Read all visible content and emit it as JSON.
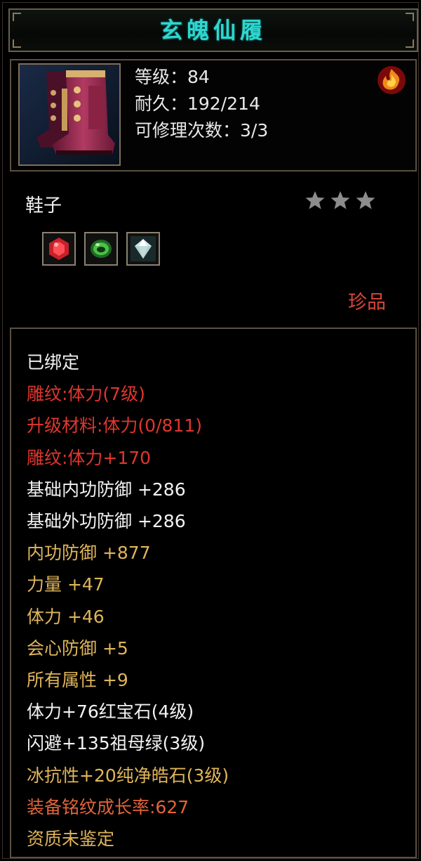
{
  "item": {
    "name": "玄魄仙履",
    "level": "等级：84",
    "durability": "耐久：192/214",
    "repair_count": "可修理次数：3/3",
    "type": "鞋子",
    "stars": 3,
    "rarity": "珍品"
  },
  "gems": [
    {
      "icon": "ruby-gem-icon",
      "color": "#c8202a"
    },
    {
      "icon": "emerald-gem-icon",
      "color": "#3aa83c"
    },
    {
      "icon": "diamond-gem-icon",
      "color": "#cfe6e6"
    }
  ],
  "attributes": [
    {
      "text": "已绑定",
      "style": "w"
    },
    {
      "text": "雕纹:体力(7级)",
      "style": "r"
    },
    {
      "text": "升级材料:体力(0/811)",
      "style": "r"
    },
    {
      "text": "雕纹:体力+170",
      "style": "r"
    },
    {
      "text": "基础内功防御  +286",
      "style": "w"
    },
    {
      "text": "基础外功防御  +286",
      "style": "w"
    },
    {
      "text": "内功防御  +877",
      "style": "g"
    },
    {
      "text": "力量  +47",
      "style": "g"
    },
    {
      "text": "体力  +46",
      "style": "g"
    },
    {
      "text": "会心防御  +5",
      "style": "g"
    },
    {
      "text": "所有属性  +9",
      "style": "g"
    },
    {
      "text": "体力+76红宝石(4级)",
      "style": "w"
    },
    {
      "text": "闪避+135祖母绿(3级)",
      "style": "w"
    },
    {
      "text": "冰抗性+20纯净皓石(3级)",
      "style": "g"
    },
    {
      "text": "装备铭纹成长率:627",
      "style": "o"
    },
    {
      "text": "资质未鉴定",
      "style": "g"
    }
  ],
  "colors": {
    "title": "#2fd6cf",
    "rare": "#d9463a",
    "red_attr": "#e0362e",
    "gold_attr": "#e0b55a",
    "orange_attr": "#e0643a"
  }
}
